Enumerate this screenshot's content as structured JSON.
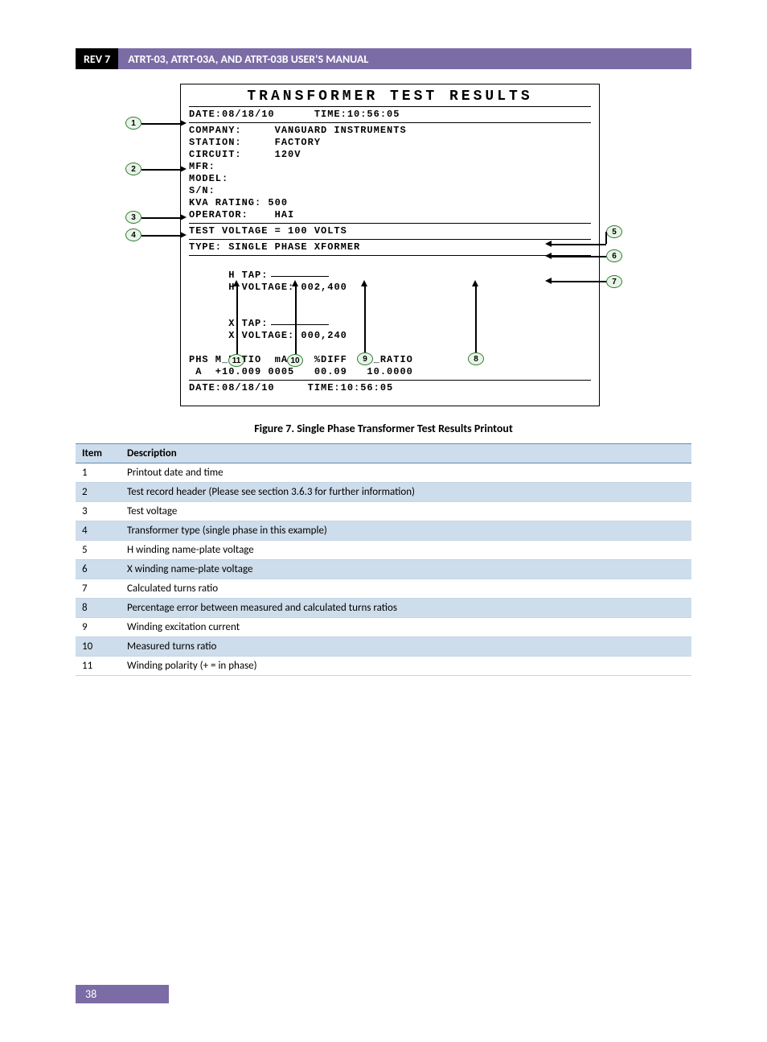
{
  "header": {
    "rev": "REV 7",
    "title": "ATRT-03, ATRT-03A, AND ATRT-03B USER'S MANUAL"
  },
  "printout": {
    "title": "TRANSFORMER TEST RESULTS",
    "line_date": "DATE:08/18/10      TIME:10:56:05",
    "company": "COMPANY:     VANGUARD INSTRUMENTS",
    "station": "STATION:     FACTORY",
    "circuit": "CIRCUIT:     120V",
    "mfr": "MFR:",
    "model": "MODEL:",
    "sn": "S/N:",
    "kva": "KVA RATING: 500",
    "operator": "OPERATOR:    HAI",
    "test_v": "TEST VOLTAGE = 100 VOLTS",
    "type": "TYPE: SINGLE PHASE XFORMER",
    "htap_l": "H TAP:",
    "htap_r": "H VOLTAGE: 002,400",
    "xtap_l": "X TAP:",
    "xtap_r": "X VOLTAGE: 000,240",
    "cols": "PHS M_RATIO  mA    %DIFF   C_RATIO",
    "vals": " A  +10.009 0005   00.09   10.0000",
    "footer": "DATE:08/18/10     TIME:10:56:05"
  },
  "bubbles": {
    "b1": "1",
    "b2": "2",
    "b3": "3",
    "b4": "4",
    "b5": "5",
    "b6": "6",
    "b7": "7",
    "b8": "8",
    "b9": "9",
    "b10": "10",
    "b11": "11"
  },
  "figure_caption": "Figure 7. Single Phase Transformer Test Results Printout",
  "table": {
    "head_item": "Item",
    "head_desc": "Description",
    "rows": [
      {
        "n": "1",
        "d": "Printout date and time"
      },
      {
        "n": "2",
        "d": "Test record header (Please see section 3.6.3 for further information)"
      },
      {
        "n": "3",
        "d": "Test voltage"
      },
      {
        "n": "4",
        "d": "Transformer type (single phase in this example)"
      },
      {
        "n": "5",
        "d": "H winding name-plate voltage"
      },
      {
        "n": "6",
        "d": "X winding name-plate voltage"
      },
      {
        "n": "7",
        "d": "Calculated turns ratio"
      },
      {
        "n": "8",
        "d": "Percentage error between measured and calculated turns ratios"
      },
      {
        "n": "9",
        "d": "Winding excitation current"
      },
      {
        "n": "10",
        "d": "Measured turns ratio"
      },
      {
        "n": "11",
        "d": "Winding polarity (+ = in phase)"
      }
    ]
  },
  "page_number": "38"
}
